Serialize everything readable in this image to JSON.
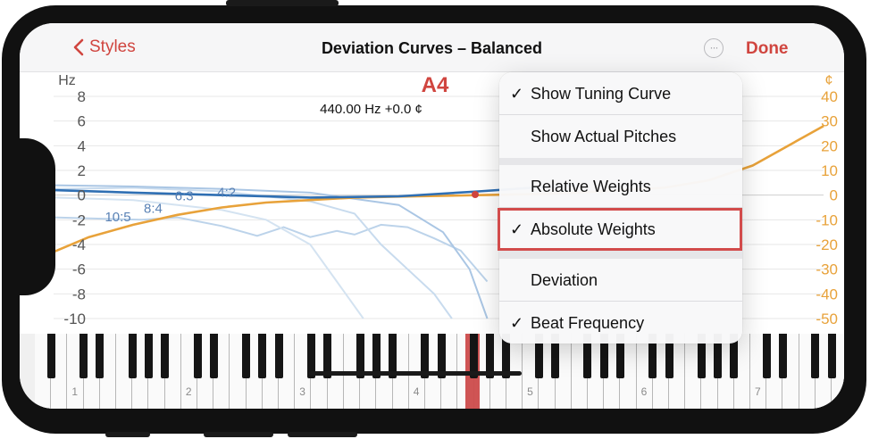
{
  "nav": {
    "back_label": "Styles",
    "title": "Deviation Curves – Balanced",
    "more_label": "···",
    "done_label": "Done"
  },
  "readout": {
    "note": "A4",
    "detail": "440.00 Hz  +0.0 ¢"
  },
  "menu": {
    "items": [
      {
        "label": "Show Tuning Curve",
        "checked": true,
        "check": "✓"
      },
      {
        "label": "Show Actual Pitches",
        "checked": false,
        "check": ""
      },
      {
        "label": "Relative Weights",
        "checked": false,
        "check": ""
      },
      {
        "label": "Absolute Weights",
        "checked": true,
        "check": "✓"
      },
      {
        "label": "Deviation",
        "checked": false,
        "check": ""
      },
      {
        "label": "Beat Frequency",
        "checked": true,
        "check": "✓"
      }
    ]
  },
  "keyboard": {
    "octave_labels": [
      "1",
      "2",
      "3",
      "4",
      "5",
      "6",
      "7"
    ],
    "selected_key": "A4"
  },
  "colors": {
    "accent": "#d0453f",
    "cents_axis": "#e8a23a",
    "hz_axis": "#444444",
    "curve_blue": "#2f6fb3"
  },
  "chart_data": {
    "type": "line",
    "left_axis": {
      "label": "Hz",
      "ticks": [
        "8",
        "6",
        "4",
        "2",
        "0",
        "-2",
        "-4",
        "-6",
        "-8",
        "-10"
      ],
      "range": [
        -10,
        8
      ]
    },
    "right_axis": {
      "label": "¢",
      "ticks": [
        "40",
        "30",
        "20",
        "10",
        "0",
        "-10",
        "-20",
        "-30",
        "-40",
        "-50"
      ],
      "range": [
        -50,
        40
      ]
    },
    "interval_labels": [
      "10:5",
      "8:4",
      "6:3",
      "4:2"
    ],
    "series": [
      {
        "color": "#e8a23a",
        "x_keys": [
          1,
          5,
          10,
          15,
          20,
          25,
          30,
          35,
          40,
          45,
          49,
          55,
          60,
          65,
          70,
          75,
          80,
          85,
          88
        ],
        "cents": [
          -23,
          -17,
          -12,
          -8,
          -5,
          -3,
          -2,
          -1,
          -0.6,
          -0.3,
          0,
          0.4,
          1,
          2,
          3,
          6,
          12,
          22,
          28
        ]
      },
      {
        "color": "#2f6fb3",
        "x_keys": [
          1,
          10,
          20,
          30,
          40,
          49,
          55,
          60
        ],
        "hz": [
          0.4,
          0.2,
          0,
          -0.2,
          -0.1,
          0.3,
          0.6,
          0.8
        ]
      }
    ]
  }
}
